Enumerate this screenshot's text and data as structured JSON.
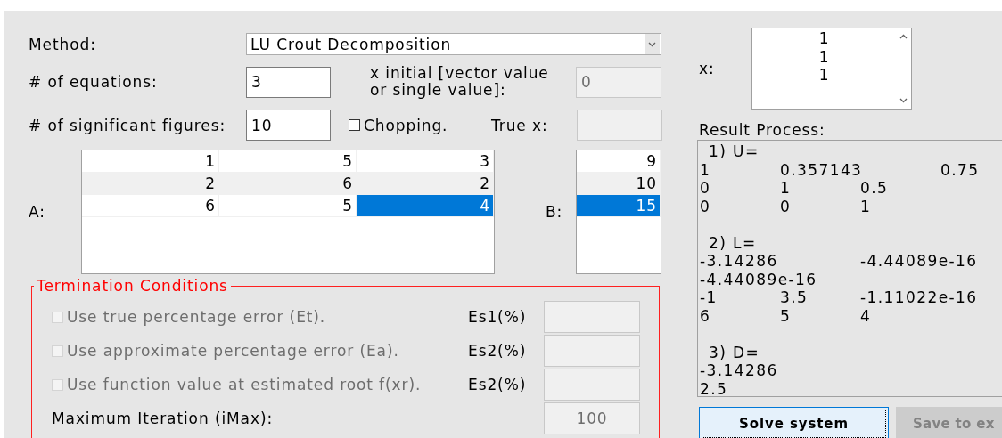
{
  "method": {
    "label": "Method:",
    "value": "LU Crout Decomposition"
  },
  "equations": {
    "label": "# of equations:",
    "value": "3"
  },
  "x_initial": {
    "label": "x initial [vector value or single value]:",
    "value": "0",
    "disabled": true
  },
  "significant_figures": {
    "label": "# of significant figures:",
    "value": "10"
  },
  "chopping": {
    "label": "Chopping.",
    "checked": false
  },
  "true_x": {
    "label": "True x:",
    "disabled": true
  },
  "matrix_a": {
    "label": "A:",
    "rows": [
      [
        {
          "value": "1",
          "selected": false
        },
        {
          "value": "5",
          "selected": false
        },
        {
          "value": "3",
          "selected": false
        }
      ],
      [
        {
          "value": "2",
          "selected": false
        },
        {
          "value": "6",
          "selected": false
        },
        {
          "value": "2",
          "selected": false
        }
      ],
      [
        {
          "value": "6",
          "selected": false
        },
        {
          "value": "5",
          "selected": false
        },
        {
          "value": "4",
          "selected": true
        }
      ]
    ]
  },
  "vector_b": {
    "label": "B:",
    "rows": [
      {
        "value": "9",
        "selected": false
      },
      {
        "value": "10",
        "selected": false
      },
      {
        "value": "15",
        "selected": true
      }
    ]
  },
  "termination": {
    "title": "Termination Conditions",
    "conditions": [
      {
        "label": "Use true percentage error (Et).",
        "checked": false,
        "disabled": true,
        "tolerance_label": "Es1(%)"
      },
      {
        "label": "Use approximate percentage error (Ea).",
        "checked": false,
        "disabled": true,
        "tolerance_label": "Es2(%)"
      },
      {
        "label": "Use function value at estimated root f(xr).",
        "checked": false,
        "disabled": true,
        "tolerance_label": "Es2(%)"
      }
    ],
    "max_iteration": {
      "label": "Maximum Iteration (iMax):",
      "value": "100",
      "disabled": true
    }
  },
  "solution": {
    "label": "x:",
    "values": [
      "1",
      "1",
      "1"
    ]
  },
  "result": {
    "label": "Result Process:",
    "blocks": [
      {
        "heading": "1) U=",
        "rows": [
          [
            "1",
            "0.357143",
            "",
            "0.75"
          ],
          [
            "0",
            "1",
            "0.5"
          ],
          [
            "0",
            "0",
            "1"
          ]
        ]
      },
      {
        "heading": "2) L=",
        "rows": [
          [
            "-3.14286",
            "",
            "-4.44089e-16"
          ],
          [
            "-4.44089e-16"
          ],
          [
            "-1",
            "3.5",
            "-1.11022e-16"
          ],
          [
            "6",
            "5",
            "4"
          ]
        ]
      },
      {
        "heading": "3) D=",
        "rows": [
          [
            "-3.14286"
          ],
          [
            "2.5"
          ]
        ]
      }
    ]
  },
  "buttons": [
    {
      "label": "Solve system",
      "disabled": false,
      "focused": true
    },
    {
      "label": "Save to ex",
      "disabled": true,
      "focused": false
    }
  ]
}
